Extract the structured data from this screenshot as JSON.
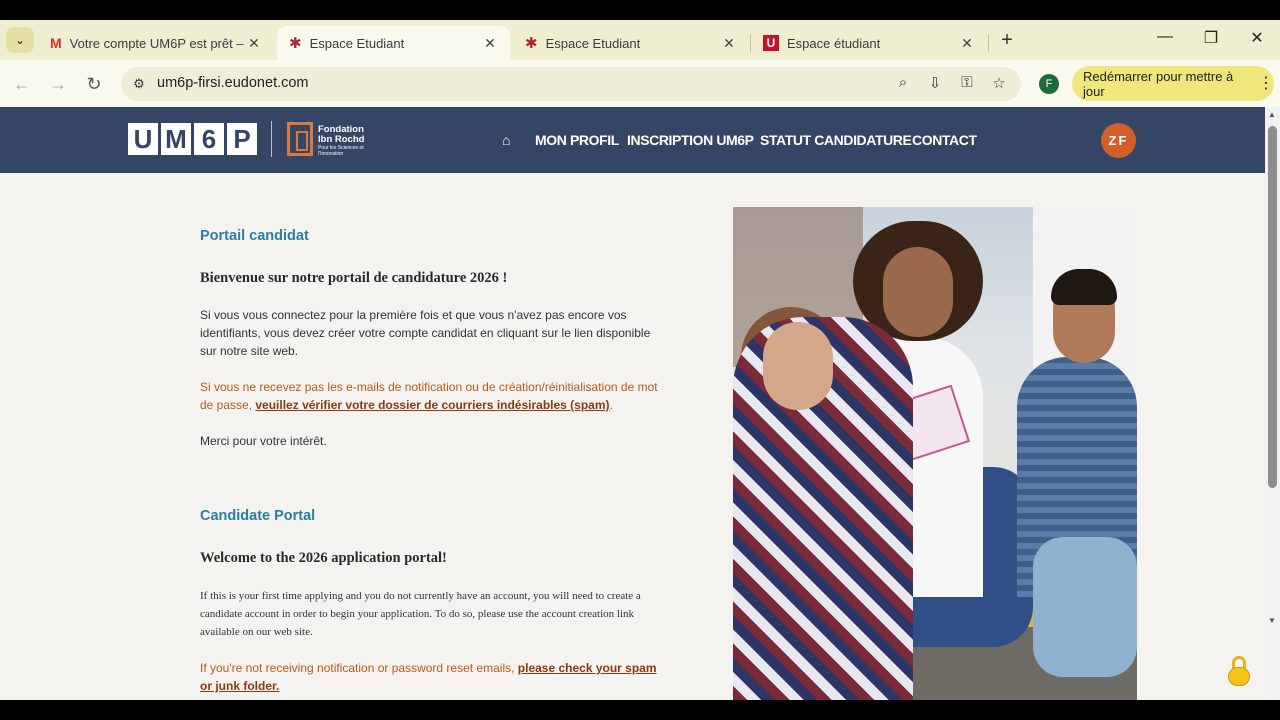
{
  "browser": {
    "tabs": [
      {
        "label": "Votre compte UM6P est prêt – (",
        "icon": "gmail-icon",
        "active": false
      },
      {
        "label": "Espace Etudiant",
        "icon": "um6p-person-icon",
        "active": true
      },
      {
        "label": "Espace Etudiant",
        "icon": "um6p-person-icon",
        "active": false
      },
      {
        "label": "Espace étudiant",
        "icon": "u-red-icon",
        "active": false
      }
    ],
    "close_glyph": "✕",
    "new_tab": "+",
    "url": "um6p-firsi.eudonet.com",
    "profile_initial": "F",
    "update_button": "Redémarrer pour mettre à jour",
    "update_menu": "⋮"
  },
  "site": {
    "logo_letters": [
      "U",
      "M",
      "6",
      "P"
    ],
    "partner_name_line1": "Fondation",
    "partner_name_line2": "Ibn Rochd",
    "partner_tagline": "Pour les Sciences et l'Innovation",
    "nav": {
      "profile": "MON PROFIL",
      "inscription": "INSCRIPTION UM6P",
      "statut": "STATUT CANDIDATURE",
      "contact": "CONTACT"
    },
    "user_initials": "ZF"
  },
  "content": {
    "fr": {
      "section_title": "Portail candidat",
      "heading": "Bienvenue sur notre portail de candidature 2026 !",
      "intro": "Si vous vous connectez pour la première fois et que vous n'avez pas encore vos identifiants, vous devez créer votre compte candidat en cliquant sur le lien disponible sur notre site web.",
      "warning_prefix": "Si vous ne recevez pas les e-mails de notification ou de création/réinitialisation de mot de passe, ",
      "warning_link": "veuillez vérifier votre dossier de courriers indésirables (spam)",
      "warning_suffix": ".",
      "thanks": "Merci pour votre intérêt."
    },
    "en": {
      "section_title": "Candidate Portal",
      "heading": "Welcome to the 2026 application portal!",
      "intro": "If this is your first time applying and you do not currently have an account, you will need to create a candidate account in order to begin your application. To do so, please use the account creation link available on our web site.",
      "warning_prefix": "If you're not receiving notification or password reset emails, ",
      "warning_link": "please check your spam or junk folder."
    }
  }
}
